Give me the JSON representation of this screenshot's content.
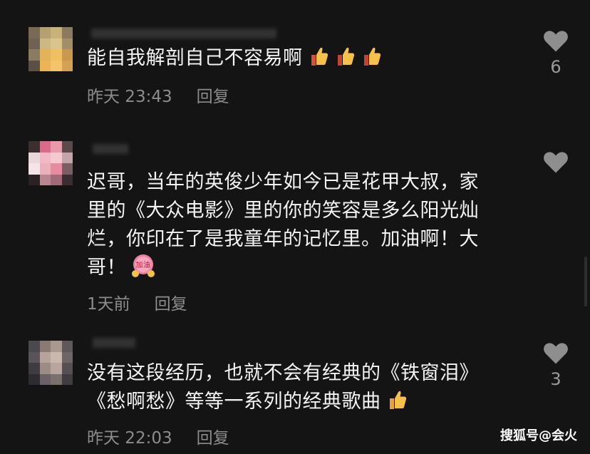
{
  "comments": [
    {
      "text_lines": [
        "能自我解剖自己不容易啊"
      ],
      "emojis": [
        "thumbs-up",
        "thumbs-up",
        "thumbs-up"
      ],
      "time": "昨天 23:43",
      "reply_label": "回复",
      "likes": "6"
    },
    {
      "text_lines": [
        "迟哥，当年的英俊少年如今已是花甲大叔，家",
        "里的《大众电影》里的你的笑容是多么阳光灿",
        "烂，你印在了是我童年的记忆里。加油啊！大",
        "哥！"
      ],
      "emojis": [
        "jiayou-emoji"
      ],
      "emoji_text": "加油",
      "time": "1天前",
      "reply_label": "回复",
      "likes": ""
    },
    {
      "text_lines": [
        "没有这段经历，也就不会有经典的《铁窗泪》",
        "《愁啊愁》等等一系列的经典歌曲"
      ],
      "emojis": [
        "thumbs-up"
      ],
      "time": "昨天 22:03",
      "reply_label": "回复",
      "likes": "3"
    }
  ],
  "watermark": "搜狐号@会火",
  "colors": {
    "background": "#141414",
    "text": "#f4f4f4",
    "meta": "#8c8c8c",
    "heart": "#8e8e8e"
  }
}
